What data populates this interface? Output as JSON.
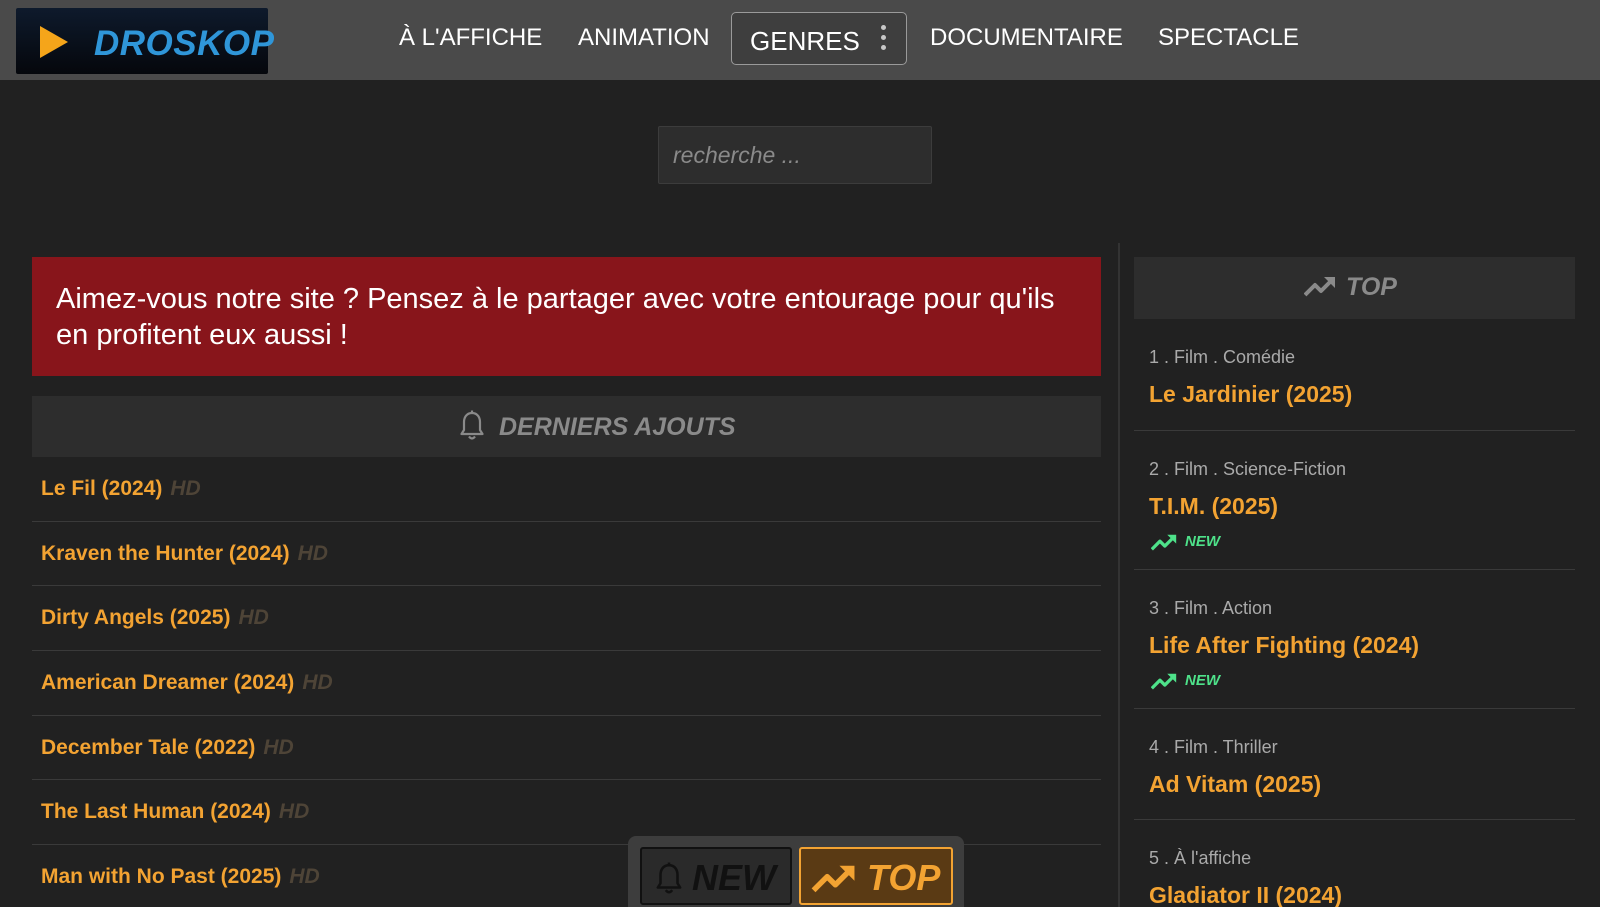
{
  "logo": {
    "text": "DROSKOP",
    "icon": "play-icon"
  },
  "nav": {
    "items": [
      "À L'AFFICHE",
      "ANIMATION",
      "GENRES",
      "DOCUMENTAIRE",
      "SPECTACLE"
    ]
  },
  "search": {
    "placeholder": "recherche ...",
    "value": ""
  },
  "banner": {
    "text": "Aimez-vous notre site ? Pensez à le partager avec votre entourage pour qu'ils en profitent eux aussi !"
  },
  "latest": {
    "title": "DERNIERS AJOUTS",
    "icon": "bell-icon",
    "badge": "HD",
    "items": [
      "Le Fil (2024)",
      "Kraven the Hunter (2024)",
      "Dirty Angels (2025)",
      "American Dreamer (2024)",
      "December Tale (2022)",
      "The Last Human (2024)",
      "Man with No Past (2025)"
    ]
  },
  "top": {
    "title": "TOP",
    "icon": "trending-up-icon",
    "new_label": "NEW",
    "new_color": "#4ee28a",
    "items": [
      {
        "meta": "1 . Film . Comédie",
        "name": "Le Jardinier (2025)",
        "is_new": false
      },
      {
        "meta": "2 . Film . Science-Fiction",
        "name": "T.I.M. (2025)",
        "is_new": true
      },
      {
        "meta": "3 . Film . Action",
        "name": "Life After Fighting (2024)",
        "is_new": true
      },
      {
        "meta": "4 . Film . Thriller",
        "name": "Ad Vitam (2025)",
        "is_new": false
      },
      {
        "meta": "5 . À l'affiche",
        "name": "Gladiator II (2024)",
        "is_new": false
      }
    ]
  },
  "floatbar": {
    "new_label": "NEW",
    "top_label": "TOP"
  },
  "colors": {
    "accent": "#f3a332",
    "banner": "#88151b",
    "logo_text": "#2f96d9",
    "header": "#4a4a4a"
  }
}
